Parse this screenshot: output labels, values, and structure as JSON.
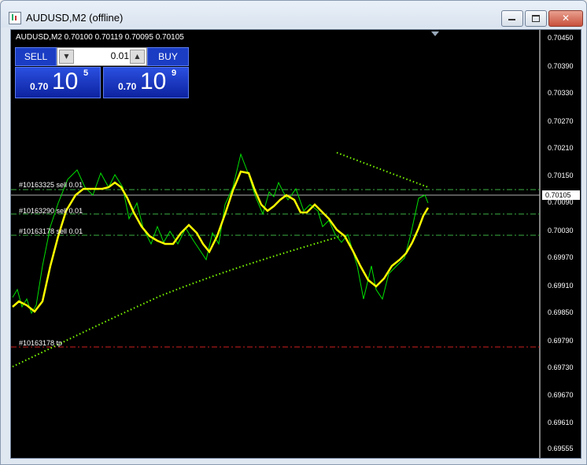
{
  "window": {
    "title": "AUDUSD,M2 (offline)",
    "controls": {
      "minimize": "minimize",
      "maximize": "maximize",
      "close": "✕"
    }
  },
  "chart": {
    "info": "AUDUSD,M2  0.70100 0.70119 0.70095 0.70105",
    "current_price": "0.70105",
    "price_axis": [
      "0.70450",
      "0.70390",
      "0.70330",
      "0.70270",
      "0.70210",
      "0.70150",
      "0.70090",
      "0.70030",
      "0.69970",
      "0.69910",
      "0.69850",
      "0.69790",
      "0.69730",
      "0.69670",
      "0.69610",
      "0.69555"
    ],
    "orders": [
      {
        "label": "#10163325 sell 0.01",
        "color": "#3cb043"
      },
      {
        "label": "#10163290 sell 0.01",
        "color": "#3cb043"
      },
      {
        "label": "#10163178 sell 0.01",
        "color": "#3cb043"
      },
      {
        "label": "#10163178 tp",
        "color": "#d02020"
      }
    ],
    "colors": {
      "background": "#000000",
      "price_line": "#00ff00",
      "ma_line": "#ffff00",
      "dotted": "#7cfc00"
    }
  },
  "trade_panel": {
    "sell_label": "SELL",
    "buy_label": "BUY",
    "lot_value": "0.01",
    "bid": {
      "prefix": "0.70",
      "big": "10",
      "sup": "5"
    },
    "ask": {
      "prefix": "0.70",
      "big": "10",
      "sup": "9"
    }
  }
}
